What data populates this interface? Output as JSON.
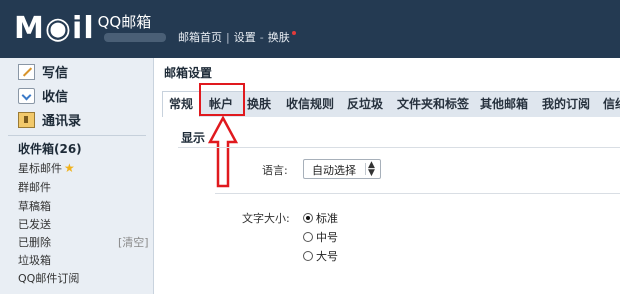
{
  "header": {
    "logo_text": "M◉il",
    "product_name": "QQ邮箱",
    "links": [
      "邮箱首页",
      "设置",
      "换肤"
    ]
  },
  "sidebar": {
    "actions": [
      {
        "label": "写信",
        "icon": "compose-icon"
      },
      {
        "label": "收信",
        "icon": "inbox-download-icon"
      },
      {
        "label": "通讯录",
        "icon": "contacts-icon"
      }
    ],
    "folders": [
      {
        "label": "收件箱(26)",
        "bold": true
      },
      {
        "label": "星标邮件",
        "icon": "star-icon"
      },
      {
        "label": "群邮件"
      },
      {
        "label": "草稿箱"
      },
      {
        "label": "已发送"
      },
      {
        "label": "已删除"
      },
      {
        "label": "垃圾箱"
      },
      {
        "label": "QQ邮件订阅"
      }
    ],
    "clear_label": "[清空]"
  },
  "main": {
    "page_title": "邮箱设置",
    "tabs": [
      "常规",
      "帐户",
      "换肤",
      "收信规则",
      "反垃圾",
      "文件夹和标签",
      "其他邮箱",
      "我的订阅",
      "信纸"
    ],
    "active_tab": "常规",
    "highlighted_tab": "帐户",
    "section_title": "显示",
    "language": {
      "label": "语言:",
      "value": "自动选择"
    },
    "font_size": {
      "label": "文字大小:",
      "options": [
        {
          "label": "标准",
          "checked": true
        },
        {
          "label": "中号",
          "checked": false
        },
        {
          "label": "大号",
          "checked": false
        }
      ]
    }
  },
  "colors": {
    "header_bg": "#243a52",
    "sidebar_bg": "#e9eef4",
    "tabbar_bg": "#dfe6ee",
    "highlight": "#e0191e"
  }
}
